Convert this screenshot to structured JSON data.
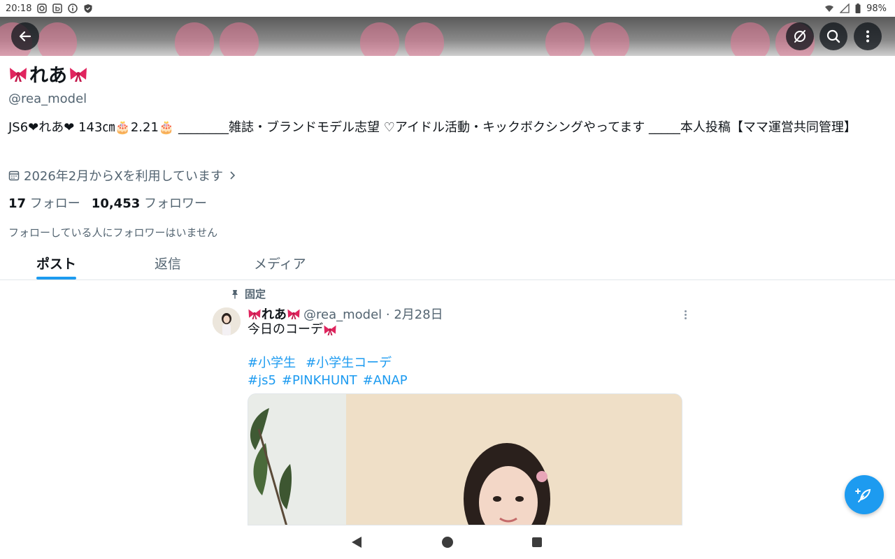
{
  "status_bar": {
    "time": "20:18",
    "battery": "98%"
  },
  "profile": {
    "name": "れあ",
    "handle": "@rea_model",
    "bio": "JS6❤れあ❤ 143㎝🎂2.21🎂 ________雑誌・ブランドモデル志望 ♡アイドル活動・キックボクシングやってます _____本人投稿【ママ運営共同管理】",
    "joined": "2026年2月からXを利用しています",
    "following_count": "17",
    "following_label": "フォロー",
    "followers_count": "10,453",
    "followers_label": "フォロワー",
    "mutual_note": "フォローしている人にフォロワーはいません"
  },
  "tabs": [
    {
      "label": "ポスト",
      "active": true
    },
    {
      "label": "返信",
      "active": false
    },
    {
      "label": "メディア",
      "active": false
    }
  ],
  "post": {
    "pinned_label": "固定",
    "display_name": "れあ",
    "meta": "@rea_model · 2月28日",
    "text": "今日のコーデ",
    "hashtags_line1": [
      "#小学生",
      "#小学生コーデ"
    ],
    "hashtags_line2": [
      "#js5",
      "#PINKHUNT",
      "#ANAP"
    ]
  },
  "icons": {
    "back": "arrow-left-icon",
    "grok": "grok-icon",
    "search": "search-icon",
    "more": "more-vertical-icon",
    "calendar": "calendar-icon",
    "chevron": "chevron-right-icon",
    "pin": "pin-icon",
    "compose": "compose-post-icon"
  },
  "colors": {
    "accent": "#1d9bf0",
    "text": "#0f1419",
    "muted": "#536471",
    "bow_red": "#e0245e"
  }
}
